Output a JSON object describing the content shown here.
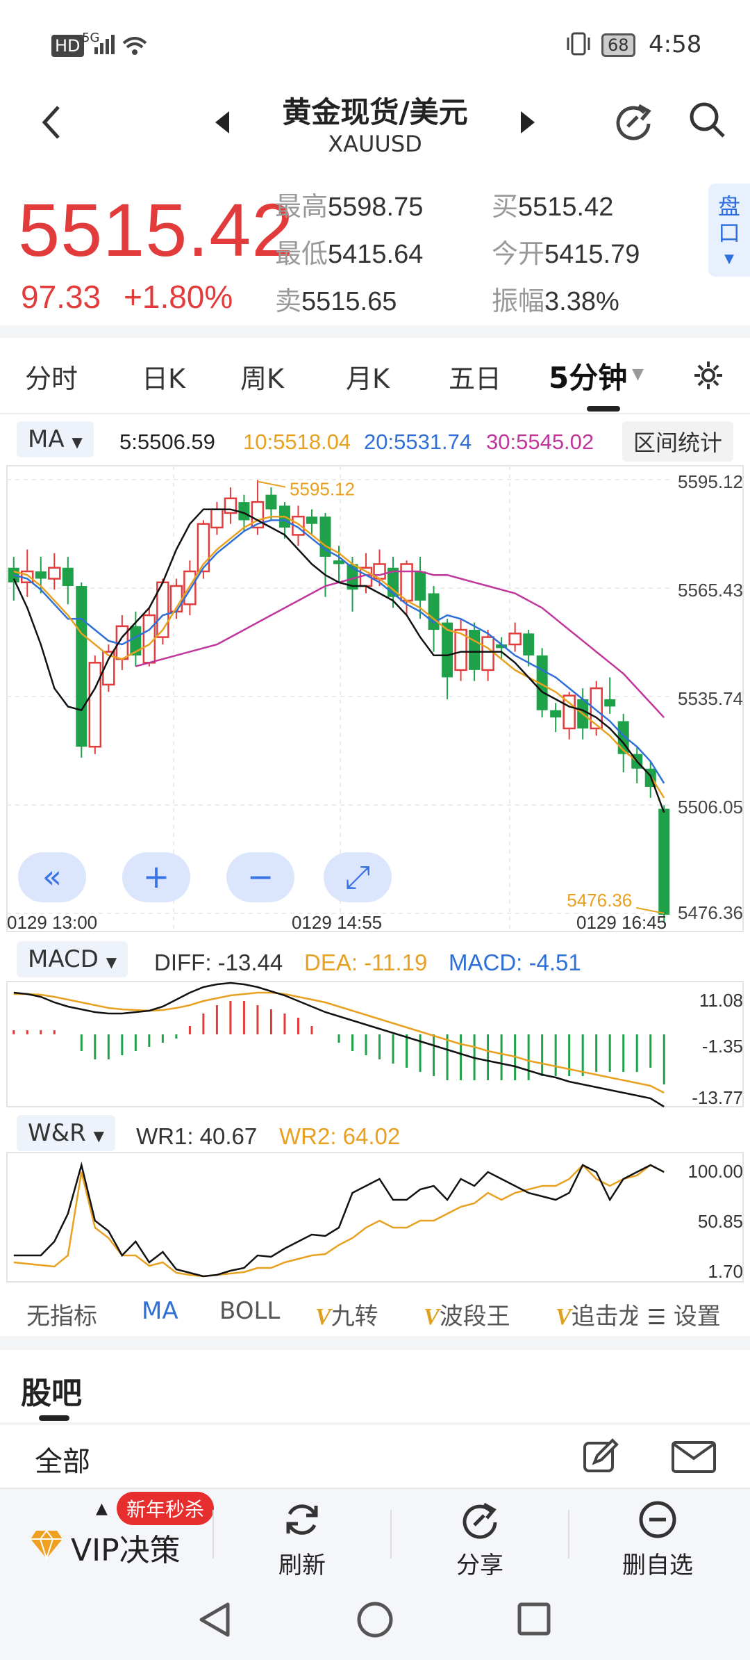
{
  "status_bar": {
    "hd": "HD",
    "net": "5G",
    "battery": "68",
    "time": "4:58"
  },
  "header": {
    "title": "黄金现货/美元",
    "subtitle": "XAUUSD"
  },
  "quote": {
    "price": "5515.42",
    "change": "97.33",
    "change_pct": "+1.80%",
    "high_label": "最高",
    "high": "5598.75",
    "low_label": "最低",
    "low": "5415.64",
    "sell_label": "卖",
    "sell": "5515.65",
    "buy_label": "买",
    "buy": "5515.42",
    "open_label": "今开",
    "open": "5415.79",
    "amp_label": "振幅",
    "amp": "3.38%",
    "pankou": "盘口"
  },
  "tabs": [
    "分时",
    "日K",
    "周K",
    "月K",
    "五日",
    "5分钟"
  ],
  "ma": {
    "selector": "MA",
    "ma5": "5:5506.59",
    "ma10": "10:5518.04",
    "ma20": "20:5531.74",
    "ma30": "30:5545.02",
    "range_button": "区间统计"
  },
  "main_chart": {
    "y_ticks": [
      "5595.12",
      "5565.43",
      "5535.74",
      "5506.05",
      "5476.36"
    ],
    "time_labels": [
      "0129  13:00",
      "0129  14:55",
      "0129  16:45"
    ],
    "max_label": "5595.12",
    "min_label": "5476.36"
  },
  "macd": {
    "selector": "MACD",
    "diff": "DIFF: -13.44",
    "dea": "DEA: -11.19",
    "macd": "MACD: -4.51",
    "y_ticks": [
      "11.08",
      "-1.35",
      "-13.77"
    ]
  },
  "wr": {
    "selector": "W&R",
    "wr1": "WR1: 40.67",
    "wr2": "WR2: 64.02",
    "y_ticks": [
      "100.00",
      "50.85",
      "1.70"
    ]
  },
  "indicators": [
    "无指标",
    "MA",
    "BOLL",
    "九转",
    "波段王",
    "追击龙",
    "设置"
  ],
  "guba": {
    "title": "股吧",
    "all": "全部"
  },
  "bottom": {
    "vip": "VIP决策",
    "badge": "新年秒杀",
    "refresh": "刷新",
    "share": "分享",
    "remove": "删自选"
  },
  "colors": {
    "up": "#e23b3b",
    "down": "#1fa14a",
    "ma5": "#111111",
    "ma10": "#e8a020",
    "ma20": "#2f6fd6",
    "ma30": "#c0369a"
  },
  "chart_data": {
    "type": "candlestick",
    "ylim": [
      5476.36,
      5595.12
    ],
    "candles": [
      [
        5571,
        5567,
        5574,
        5562
      ],
      [
        5567,
        5570,
        5576,
        5563
      ],
      [
        5570,
        5568,
        5574,
        5564
      ],
      [
        5568,
        5571,
        5575,
        5565
      ],
      [
        5571,
        5566,
        5574,
        5561
      ],
      [
        5566,
        5522,
        5567,
        5519
      ],
      [
        5522,
        5545,
        5547,
        5520
      ],
      [
        5539,
        5548,
        5550,
        5537
      ],
      [
        5546,
        5555,
        5558,
        5543
      ],
      [
        5555,
        5547,
        5559,
        5544
      ],
      [
        5545,
        5558,
        5560,
        5544
      ],
      [
        5552,
        5567,
        5568,
        5550
      ],
      [
        5559,
        5566,
        5568,
        5557
      ],
      [
        5561,
        5570,
        5573,
        5558
      ],
      [
        5570,
        5583,
        5584,
        5568
      ],
      [
        5582,
        5587,
        5589,
        5580
      ],
      [
        5586,
        5590,
        5593,
        5583
      ],
      [
        5589,
        5584,
        5591,
        5581
      ],
      [
        5582,
        5589,
        5595,
        5580
      ],
      [
        5591,
        5587,
        5593,
        5584
      ],
      [
        5588,
        5582,
        5589,
        5579
      ],
      [
        5580,
        5585,
        5588,
        5577
      ],
      [
        5585,
        5583,
        5587,
        5580
      ],
      [
        5585,
        5574,
        5586,
        5563
      ],
      [
        5573,
        5572,
        5577,
        5567
      ],
      [
        5572,
        5565,
        5574,
        5559
      ],
      [
        5566,
        5571,
        5575,
        5564
      ],
      [
        5568,
        5572,
        5576,
        5566
      ],
      [
        5571,
        5563,
        5574,
        5560
      ],
      [
        5562,
        5572,
        5573,
        5558
      ],
      [
        5570,
        5562,
        5574,
        5557
      ],
      [
        5564,
        5554,
        5566,
        5548
      ],
      [
        5556,
        5541,
        5557,
        5535
      ],
      [
        5543,
        5554,
        5557,
        5540
      ],
      [
        5554,
        5543,
        5556,
        5540
      ],
      [
        5543,
        5552,
        5554,
        5540
      ],
      [
        5550,
        5549,
        5552,
        5546
      ],
      [
        5550,
        5553,
        5556,
        5548
      ],
      [
        5553,
        5547,
        5554,
        5544
      ],
      [
        5547,
        5532,
        5549,
        5530
      ],
      [
        5532,
        5530,
        5534,
        5526
      ],
      [
        5527,
        5536,
        5537,
        5524
      ],
      [
        5535,
        5527,
        5538,
        5524
      ],
      [
        5527,
        5538,
        5540,
        5525
      ],
      [
        5535,
        5533,
        5541,
        5531
      ],
      [
        5529,
        5520,
        5531,
        5515
      ],
      [
        5520,
        5516,
        5522,
        5512
      ],
      [
        5516,
        5511,
        5518,
        5508
      ],
      [
        5505,
        5476,
        5506,
        5474
      ]
    ],
    "ma5": [
      5568,
      5560,
      5550,
      5538,
      5533,
      5532,
      5538,
      5546,
      5552,
      5556,
      5560,
      5567,
      5576,
      5583,
      5587,
      5587,
      5587,
      5586,
      5584,
      5582,
      5580,
      5576,
      5572,
      5569,
      5567,
      5566,
      5566,
      5564,
      5562,
      5558,
      5552,
      5547,
      5547,
      5548,
      5548,
      5548,
      5548,
      5545,
      5541,
      5537,
      5535,
      5533,
      5532,
      5530,
      5527,
      5523,
      5518,
      5514,
      5504
    ],
    "ma10": [
      5570,
      5569,
      5566,
      5562,
      5558,
      5553,
      5550,
      5547,
      5546,
      5548,
      5550,
      5554,
      5560,
      5566,
      5572,
      5576,
      5579,
      5582,
      5584,
      5585,
      5585,
      5583,
      5580,
      5577,
      5575,
      5572,
      5570,
      5568,
      5565,
      5562,
      5560,
      5557,
      5554,
      5553,
      5551,
      5549,
      5546,
      5543,
      5541,
      5539,
      5537,
      5534,
      5531,
      5528,
      5525,
      5521,
      5518,
      5514,
      5508
    ],
    "ma20": [
      5544,
      5545,
      5546,
      5547,
      5548,
      5549,
      5550,
      5552,
      5554,
      5556,
      5558,
      5560,
      5562,
      5564,
      5566,
      5567,
      5568,
      5569,
      5569,
      5570,
      5570,
      5570,
      5569,
      5569,
      5568,
      5567,
      5566,
      5565,
      5564,
      5562,
      5560,
      5557,
      5554,
      5551,
      5548,
      5545,
      5542,
      5538,
      5534,
      5530
    ]
  }
}
